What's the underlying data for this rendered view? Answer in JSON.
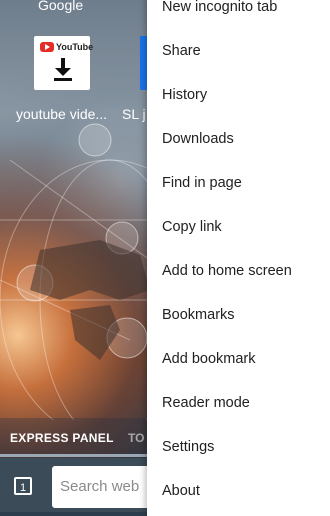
{
  "background": {
    "top_tile_label": "Google"
  },
  "speed_dial": {
    "tile1": {
      "logo_text": "YouTube",
      "label": "youtube vide..."
    },
    "tile2": {
      "label": "SL j"
    }
  },
  "express_bar": {
    "tab1": "EXPRESS PANEL",
    "tab2": "TO"
  },
  "bottom_bar": {
    "tabs_count": "1",
    "search_placeholder": "Search web"
  },
  "menu": {
    "items": [
      {
        "label": "New incognito tab"
      },
      {
        "label": "Share"
      },
      {
        "label": "History"
      },
      {
        "label": "Downloads"
      },
      {
        "label": "Find in page"
      },
      {
        "label": "Copy link"
      },
      {
        "label": "Add to home screen"
      },
      {
        "label": "Bookmarks"
      },
      {
        "label": "Add bookmark"
      },
      {
        "label": "Reader mode"
      },
      {
        "label": "Settings"
      },
      {
        "label": "About"
      }
    ]
  },
  "colors": {
    "menu_bg": "#ffffff",
    "menu_text": "#212121",
    "accent": "#1a73e8",
    "youtube_red": "#e52d27"
  }
}
